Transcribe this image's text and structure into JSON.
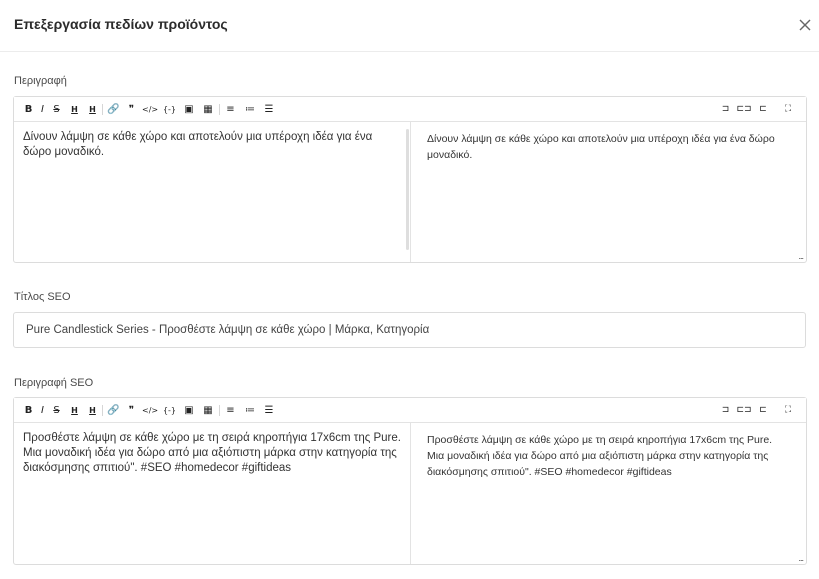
{
  "modal": {
    "title": "Επεξεργασία πεδίων προϊόντος"
  },
  "toolbar_left": [
    {
      "name": "bold-button",
      "glyph": "B"
    },
    {
      "name": "italic-button",
      "glyph": "I"
    },
    {
      "name": "strikethrough-button",
      "glyph": "S"
    },
    {
      "name": "heading-button",
      "glyph": "H"
    },
    {
      "name": "heading-alt-button",
      "glyph": "H"
    },
    {
      "name": "link-button",
      "glyph": "🔗"
    },
    {
      "name": "quote-button",
      "glyph": "❞"
    },
    {
      "name": "code-button",
      "glyph": "</>"
    },
    {
      "name": "code-block-button",
      "glyph": "{-}"
    },
    {
      "name": "comment-button",
      "glyph": "▣"
    },
    {
      "name": "image-button",
      "glyph": "▦"
    },
    {
      "name": "bullet-list-button",
      "glyph": "≡"
    },
    {
      "name": "ordered-list-button",
      "glyph": "≔"
    },
    {
      "name": "task-list-button",
      "glyph": "☰"
    }
  ],
  "toolbar_right": [
    {
      "name": "edit-mode-button",
      "glyph": "⊐"
    },
    {
      "name": "split-mode-button",
      "glyph": "⊏⊐"
    },
    {
      "name": "preview-mode-button",
      "glyph": "⊏"
    },
    {
      "name": "fullscreen-button",
      "glyph": "⛶"
    }
  ],
  "description": {
    "label": "Περιγραφή",
    "markdown": "Δίνουν λάμψη σε κάθε χώρο και αποτελούν μια υπέροχη ιδέα για ένα δώρο μοναδικό.",
    "preview": "Δίνουν λάμψη σε κάθε χώρο και αποτελούν μια υπέροχη ιδέα για ένα δώρο μοναδικό."
  },
  "seo_title": {
    "label": "Τίτλος SEO",
    "value": "Pure Candlestick Series - Προσθέστε λάμψη σε κάθε χώρο | Μάρκα, Κατηγορία"
  },
  "seo_description": {
    "label": "Περιγραφή SEO",
    "markdown": "Προσθέστε λάμψη σε κάθε χώρο με τη σειρά κηροπήγια 17x6cm της Pure. Μια μοναδική ιδέα για δώρο από μια αξιόπιστη μάρκα στην κατηγορία της διακόσμησης σπιτιού\". #SEO #homedecor #giftideas",
    "preview": "Προσθέστε λάμψη σε κάθε χώρο με τη σειρά κηροπήγια 17x6cm της Pure. Μια μοναδική ιδέα για δώρο από μια αξιόπιστη μάρκα στην κατηγορία της διακόσμησης σπιτιού\". #SEO #homedecor #giftideas"
  },
  "resize_handle": "..."
}
